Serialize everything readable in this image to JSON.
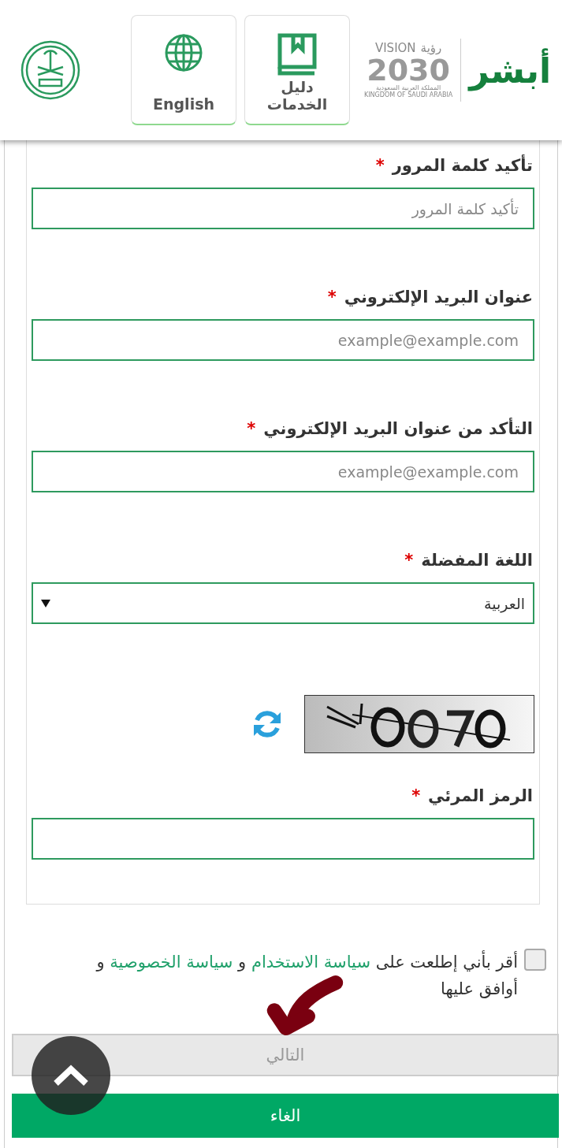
{
  "header": {
    "absher_logo": "أبشر",
    "vision_logo": {
      "vision": "VISION",
      "ruya": "رؤية",
      "year": "2030",
      "country_ar": "المملكة العربية السعودية",
      "country_en": "KINGDOM OF SAUDI ARABIA"
    },
    "buttons": [
      {
        "kind": "guide",
        "label": "دليل الخدمات"
      },
      {
        "kind": "language",
        "label": "English"
      }
    ]
  },
  "form": {
    "fields": [
      {
        "kind": "input",
        "label": "تأكيد كلمة المرور",
        "required_mark": "*",
        "placeholder": "تأكيد كلمة المرور"
      },
      {
        "kind": "input",
        "label": "عنوان البريد الإلكتروني",
        "required_mark": "*",
        "placeholder": "example@example.com"
      },
      {
        "kind": "input",
        "label": "التأكد من عنوان البريد الإلكتروني",
        "required_mark": "*",
        "placeholder": "example@example.com"
      },
      {
        "kind": "select",
        "label": "اللغة المفضلة",
        "required_mark": "*",
        "value": "العربية"
      },
      {
        "kind": "captcha",
        "label": "الرمز المرئي",
        "required_mark": "*"
      }
    ]
  },
  "agreement": {
    "checked": false,
    "before": "أقر بأني إطلعت على",
    "link1": "سياسة الاستخدام",
    "joiner": "و",
    "link2": "سياسة الخصوصية",
    "after": "و أوافق عليها"
  },
  "buttons": [
    {
      "kind": "next",
      "label": "التالي",
      "disabled": true
    },
    {
      "kind": "cancel",
      "label": "الغاء",
      "disabled": false
    }
  ],
  "annotation": {
    "kind": "arrow"
  }
}
